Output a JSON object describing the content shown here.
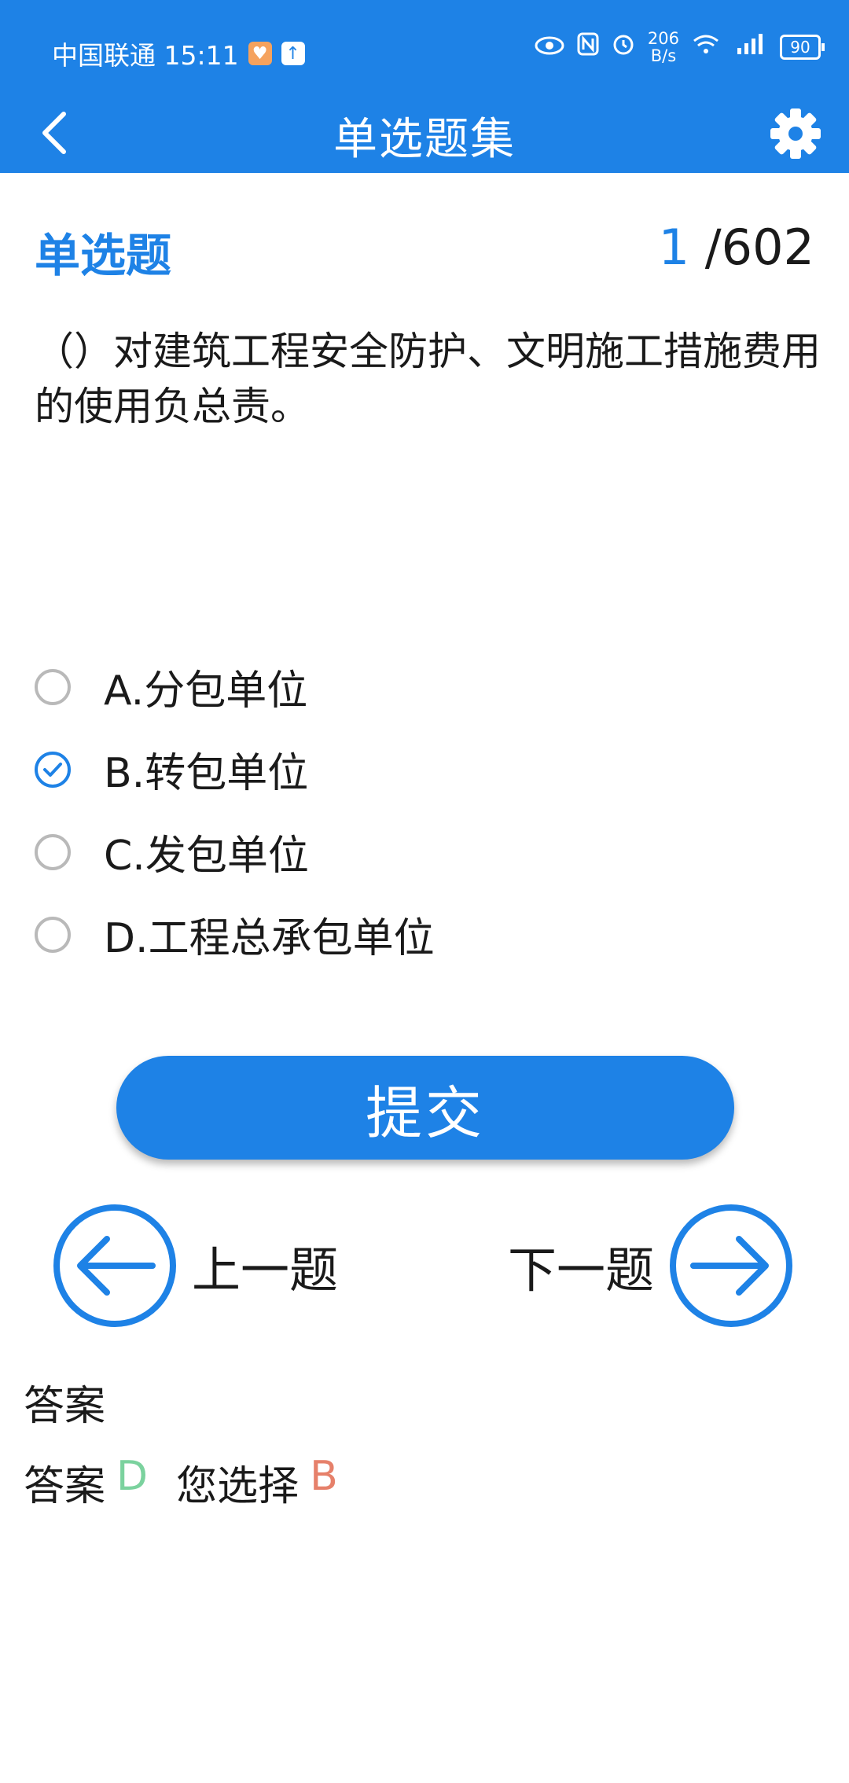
{
  "status_bar": {
    "carrier_time": "中国联通 15:11",
    "speed_value": "206",
    "speed_unit": "B/s",
    "battery": "90"
  },
  "app_bar": {
    "title": "单选题集",
    "back_icon": "chevron-left-icon",
    "settings_icon": "gear-icon"
  },
  "question": {
    "type": "单选题",
    "current": "1",
    "total": "/602",
    "text": "（）对建筑工程安全防护、文明施工措施费用的使用负总责。"
  },
  "options": [
    {
      "label": "A.分包单位",
      "checked": false
    },
    {
      "label": "B.转包单位",
      "checked": true
    },
    {
      "label": "C.发包单位",
      "checked": false
    },
    {
      "label": "D.工程总承包单位",
      "checked": false
    }
  ],
  "actions": {
    "submit": "提交",
    "prev": "上一题",
    "next": "下一题"
  },
  "answer": {
    "heading": "答案",
    "answer_label": "答案",
    "answer_value": "D",
    "chosen_label": "您选择",
    "chosen_value": "B"
  },
  "colors": {
    "primary": "#1e82e6",
    "correct": "#7bd29e",
    "wrong": "#e6806a"
  }
}
